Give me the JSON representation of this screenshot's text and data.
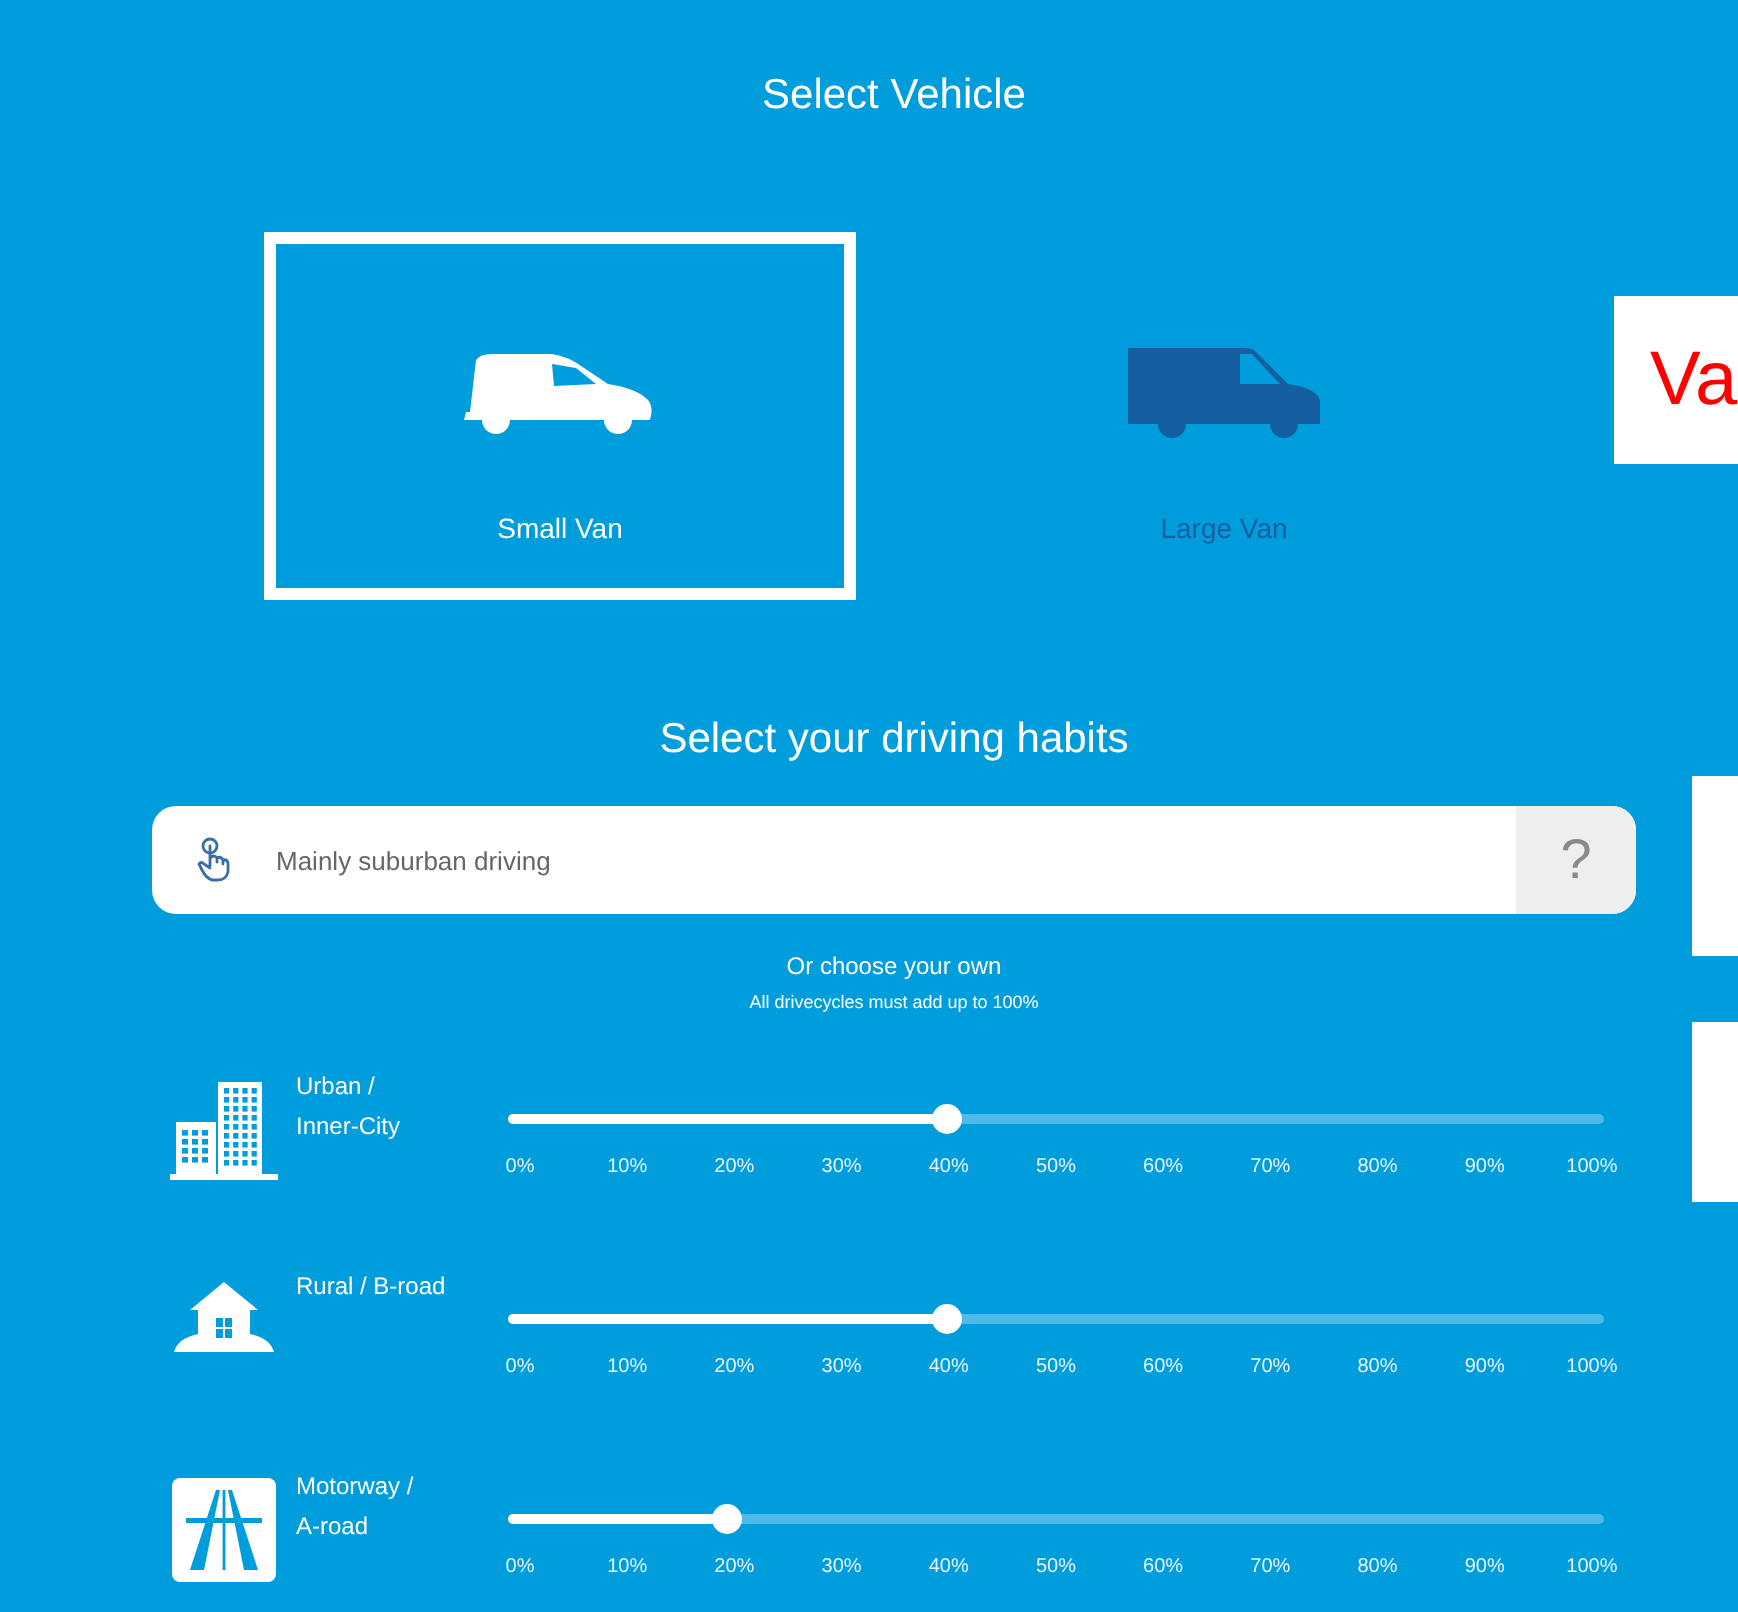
{
  "title": "Select Vehicle",
  "vehicles": [
    {
      "label": "Small Van",
      "kind": "small",
      "selected": true
    },
    {
      "label": "Large Van",
      "kind": "large",
      "selected": false
    }
  ],
  "habits_title": "Select your driving habits",
  "preset": {
    "value": "Mainly suburban driving",
    "help": "?"
  },
  "custom_title": "Or choose your own",
  "custom_note": "All drivecycles must add up to 100%",
  "cycles": [
    {
      "kind": "urban",
      "label_lines": [
        "Urban /",
        "Inner-City"
      ],
      "level": 0.4,
      "ticks": [
        "0%",
        "10%",
        "20%",
        "30%",
        "40%",
        "50%",
        "60%",
        "70%",
        "80%",
        "90%",
        "100%"
      ]
    },
    {
      "kind": "rural",
      "label_lines": [
        "Rural / B-road"
      ],
      "level": 0.4,
      "ticks": [
        "0%",
        "10%",
        "20%",
        "30%",
        "40%",
        "50%",
        "60%",
        "70%",
        "80%",
        "90%",
        "100%"
      ]
    },
    {
      "kind": "motorway",
      "label_lines": [
        "Motorway /",
        "A-road"
      ],
      "level": 0.2,
      "ticks": [
        "0%",
        "10%",
        "20%",
        "30%",
        "40%",
        "50%",
        "60%",
        "70%",
        "80%",
        "90%",
        "100%"
      ]
    }
  ],
  "callouts": [
    "Va"
  ]
}
